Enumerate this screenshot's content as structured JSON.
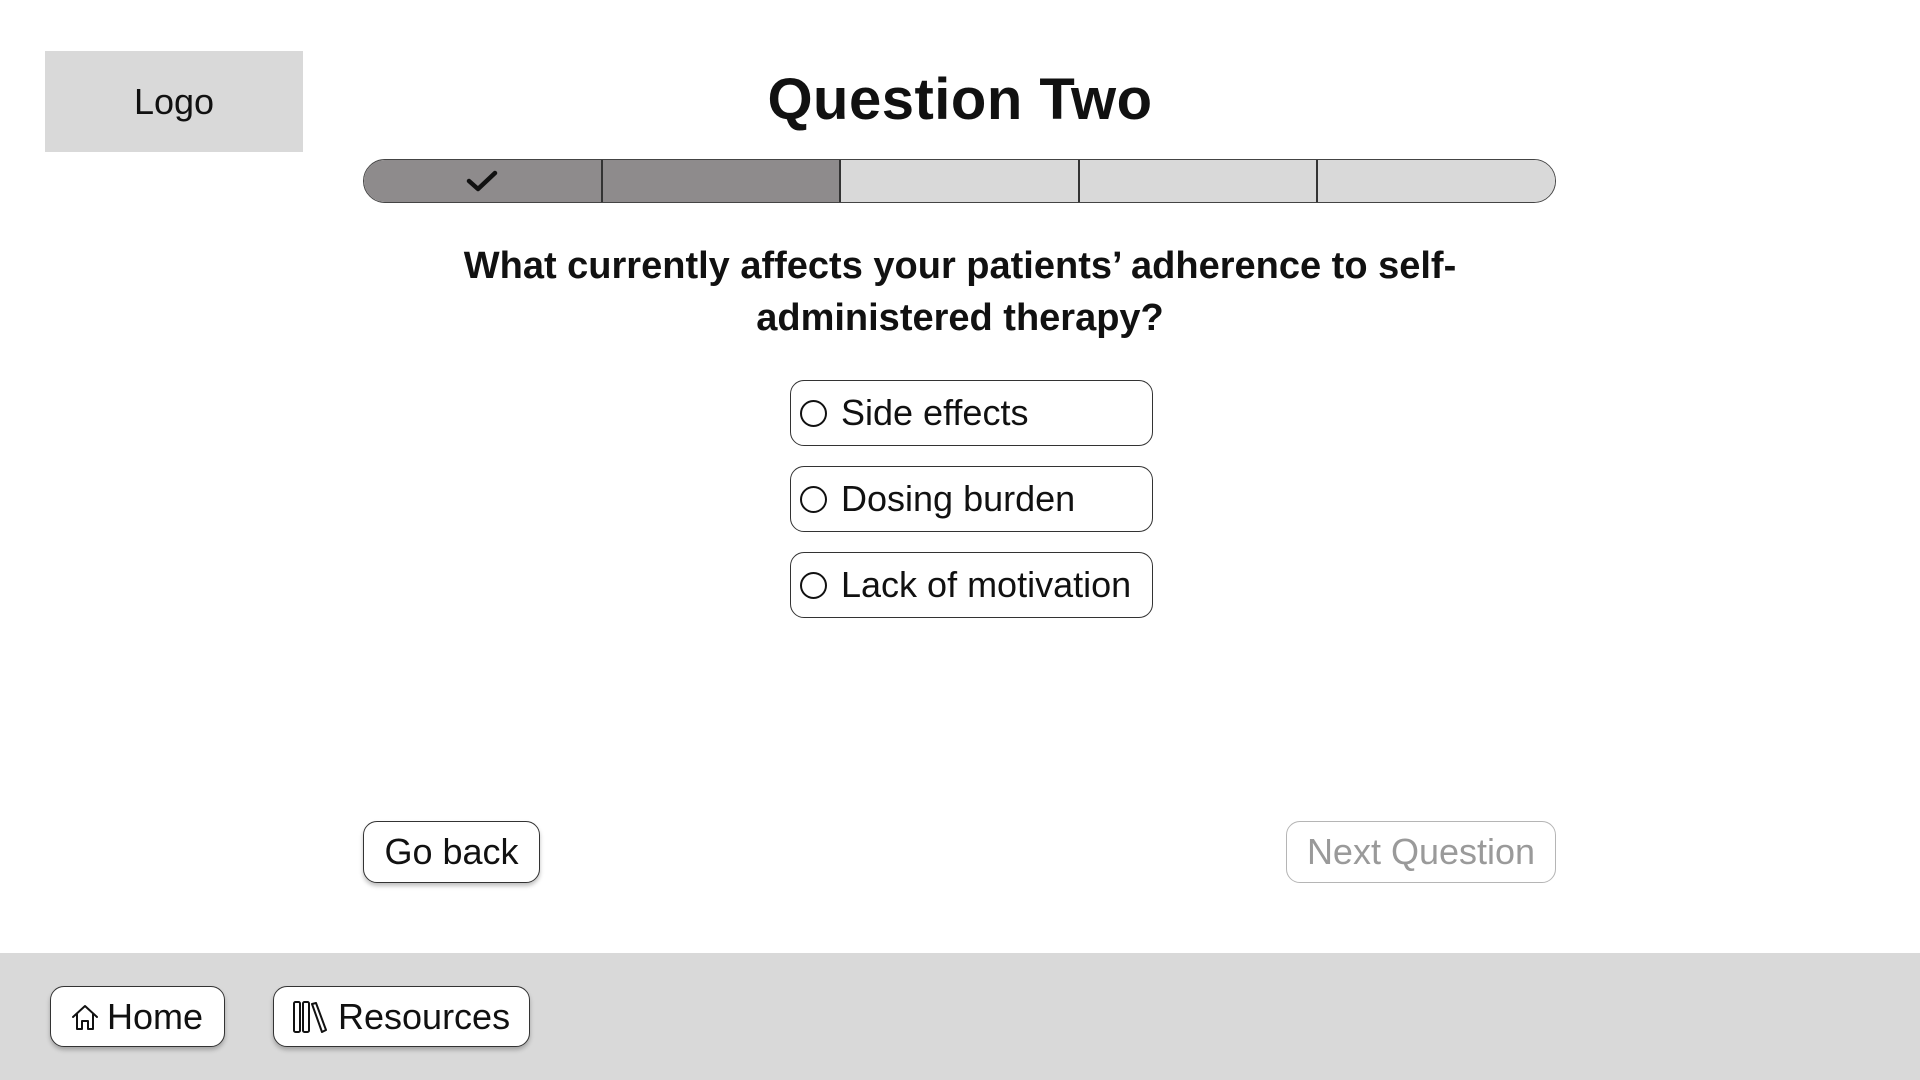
{
  "logo": {
    "label": "Logo"
  },
  "header": {
    "title": "Question Two"
  },
  "progress": {
    "total_steps": 5,
    "current_step": 2,
    "steps": [
      {
        "state": "completed",
        "icon": "check-icon"
      },
      {
        "state": "current"
      },
      {
        "state": "upcoming"
      },
      {
        "state": "upcoming"
      },
      {
        "state": "upcoming"
      }
    ],
    "colors": {
      "filled": "#8e8b8c",
      "empty": "#d9d9d9"
    }
  },
  "question": {
    "text": "What currently affects your patients’ adherence to self-administered therapy?",
    "options": [
      {
        "label": "Side effects",
        "selected": false
      },
      {
        "label": "Dosing burden",
        "selected": false
      },
      {
        "label": "Lack of motivation",
        "selected": false
      }
    ]
  },
  "navigation": {
    "back_label": "Go back",
    "next_label": "Next Question",
    "next_enabled": false
  },
  "footer": {
    "home_label": "Home",
    "home_icon": "home-icon",
    "resources_label": "Resources",
    "resources_icon": "books-icon"
  }
}
